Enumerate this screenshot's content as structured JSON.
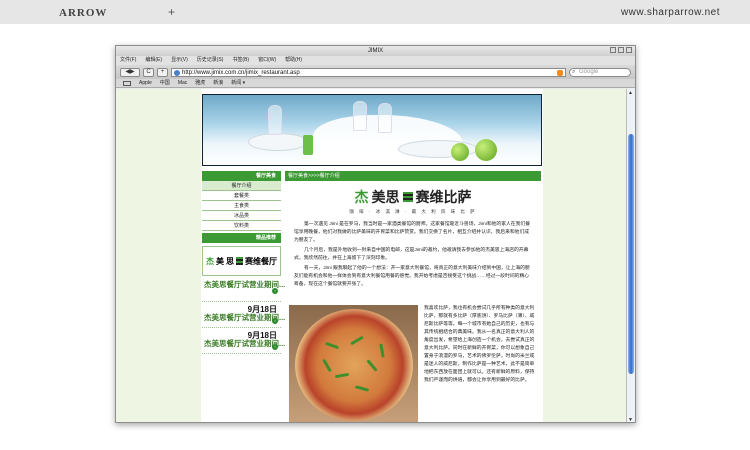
{
  "header": {
    "logo": "ARROW",
    "plus": "+",
    "site": "www.sharparrow.net"
  },
  "browser": {
    "title": "JIMIX",
    "menu": [
      "文件(F)",
      "编辑(E)",
      "显示(V)",
      "历史记录(S)",
      "书签(B)",
      "窗口(W)",
      "帮助(H)"
    ],
    "back": "◀",
    "forward": "▶",
    "reload": "C",
    "add": "+",
    "url": "http://www.jimix.com.cn/jimix_restaurant.asp",
    "search_placeholder": "Google",
    "bookmarks": [
      "Apple",
      "中国",
      "Mac",
      "雅虎",
      "新浪",
      "新闻"
    ],
    "bookmarks_more": "新闻 ▾"
  },
  "sidebar": {
    "title": "餐厅美食",
    "items": [
      "餐厅介绍",
      "套餐类",
      "主食类",
      "冰品类",
      "饮料类"
    ],
    "news_title": "精品推荐",
    "brand": {
      "a": "杰",
      "b": "美",
      "c": "思",
      "d": "赛维餐厅"
    },
    "news": [
      {
        "date": "",
        "title": "杰美思餐厅试营业期间..."
      },
      {
        "date": "9月18日",
        "title": "杰美思餐厅试营业期间..."
      },
      {
        "date": "9月18日",
        "title": "杰美思餐厅试营业期间..."
      }
    ]
  },
  "content": {
    "breadcrumb": "餐厅美食>>>>餐厅介绍",
    "logo_a": "杰",
    "logo_b": "美思",
    "logo_c": "赛维比萨",
    "tagline": "咖 啡 · 冰 淇 淋 · 最 大 利 风 味 比 萨",
    "para1": "第一次遇见 Jimi 是在罗马，我当时是一家酒类餐馆的厨师。这家餐馆靠近斗兽场，Jimi和他的家人在我们餐馆享用晚餐，他们对我做的比萨美味的开胃菜和比萨赞赏。我们交换了名片，相互介绍并认识，我后来和他们成为朋友了。",
    "para2": "几个月后，我是外地收到一封来自中国的电邮，这是Jimi的邀约，他邀请我去参加他的杰美思上海店的开幕式，我欣然前往，并在上海留下了深刻印象。",
    "para3": "有一天，Jimi 跟我聊起了他的一个想法：开一家意大利餐馆，将真正的意大利美味介绍到中国，让上海的朋友们能有机会和他一样体会到有意大利餐馆用餐的感觉。我开始考虑是否接受这个挑战……经过一段时间的精心筹备，现在这个餐馆就要开张了。",
    "side1": "我喜欢比萨，我也有机会尝试几乎所有种类的意大利比萨，那就有多比萨（厚底饼）、罗马比萨（薄）、威尼斯比萨等等。每一个城市有她自己的历史，也有与其传统相结合的典美味。我从一名真正的意大利人的角度出发，希望给上海创造一个机会，去尝试真正的意大利比萨。同时在新鲜的开胃菜，你可以想象自己置身于浪漫的罗马，艺术的佛罗伦萨，时尚的米兰或是迷人的威尼斯，制作比萨是一种艺术，此不是简单地把东西放在面团上就可以。还有新鲜的原料，保持我们严谨而的烘焙，都会让你享用到最好的比萨。"
  },
  "colors": {
    "green": "#3b9a33",
    "page_bg": "#eef5e2"
  }
}
